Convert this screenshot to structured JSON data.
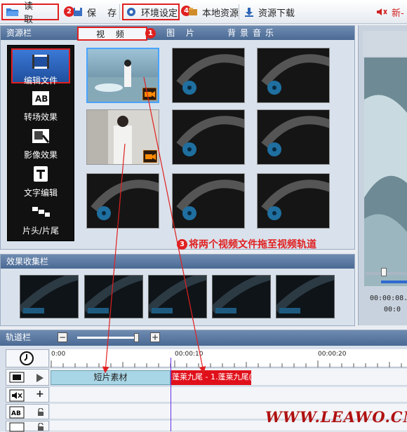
{
  "toolbar": {
    "read_label": "读 取",
    "save_label": "保 存",
    "settings_label": "环境设定",
    "local_label": "本地资源",
    "download_label": "资源下载",
    "new_label": "新-"
  },
  "badges": {
    "b1": "1",
    "b2": "2",
    "b3": "3",
    "b4": "4"
  },
  "resource_panel": {
    "title": "资源栏",
    "tabs": [
      "视 频",
      "图 片",
      "背景音乐"
    ]
  },
  "sidebar": {
    "items": [
      {
        "label": "编辑文件",
        "icon": "film-edit-icon"
      },
      {
        "label": "转场效果",
        "icon": "transition-ab-icon"
      },
      {
        "label": "影像效果",
        "icon": "image-effect-icon"
      },
      {
        "label": "文字编辑",
        "icon": "text-t-icon"
      },
      {
        "label": "片头/片尾",
        "icon": "intro-outro-icon"
      }
    ]
  },
  "annotation": {
    "text": "将两个视频文件拖至视频轨道"
  },
  "effects_panel": {
    "title": "效果收集栏"
  },
  "preview": {
    "time1": "00:00:08.",
    "time2": "00:0"
  },
  "track_panel": {
    "title": "轨道栏",
    "ruler": [
      "0:00",
      "00:00:10",
      "00:00:20"
    ],
    "clip1": "短片素材",
    "clip2": "蓬莱九尾 - 1.蓬莱九尾(",
    "zoom_minus": "−",
    "zoom_plus": "+"
  },
  "watermark": "WWW.LEAWO.CN",
  "colors": {
    "accent_red": "#e02020",
    "panel_blue": "#4a6a94",
    "clip_blue": "#a9d6e6",
    "clip_red": "#e0101a"
  }
}
